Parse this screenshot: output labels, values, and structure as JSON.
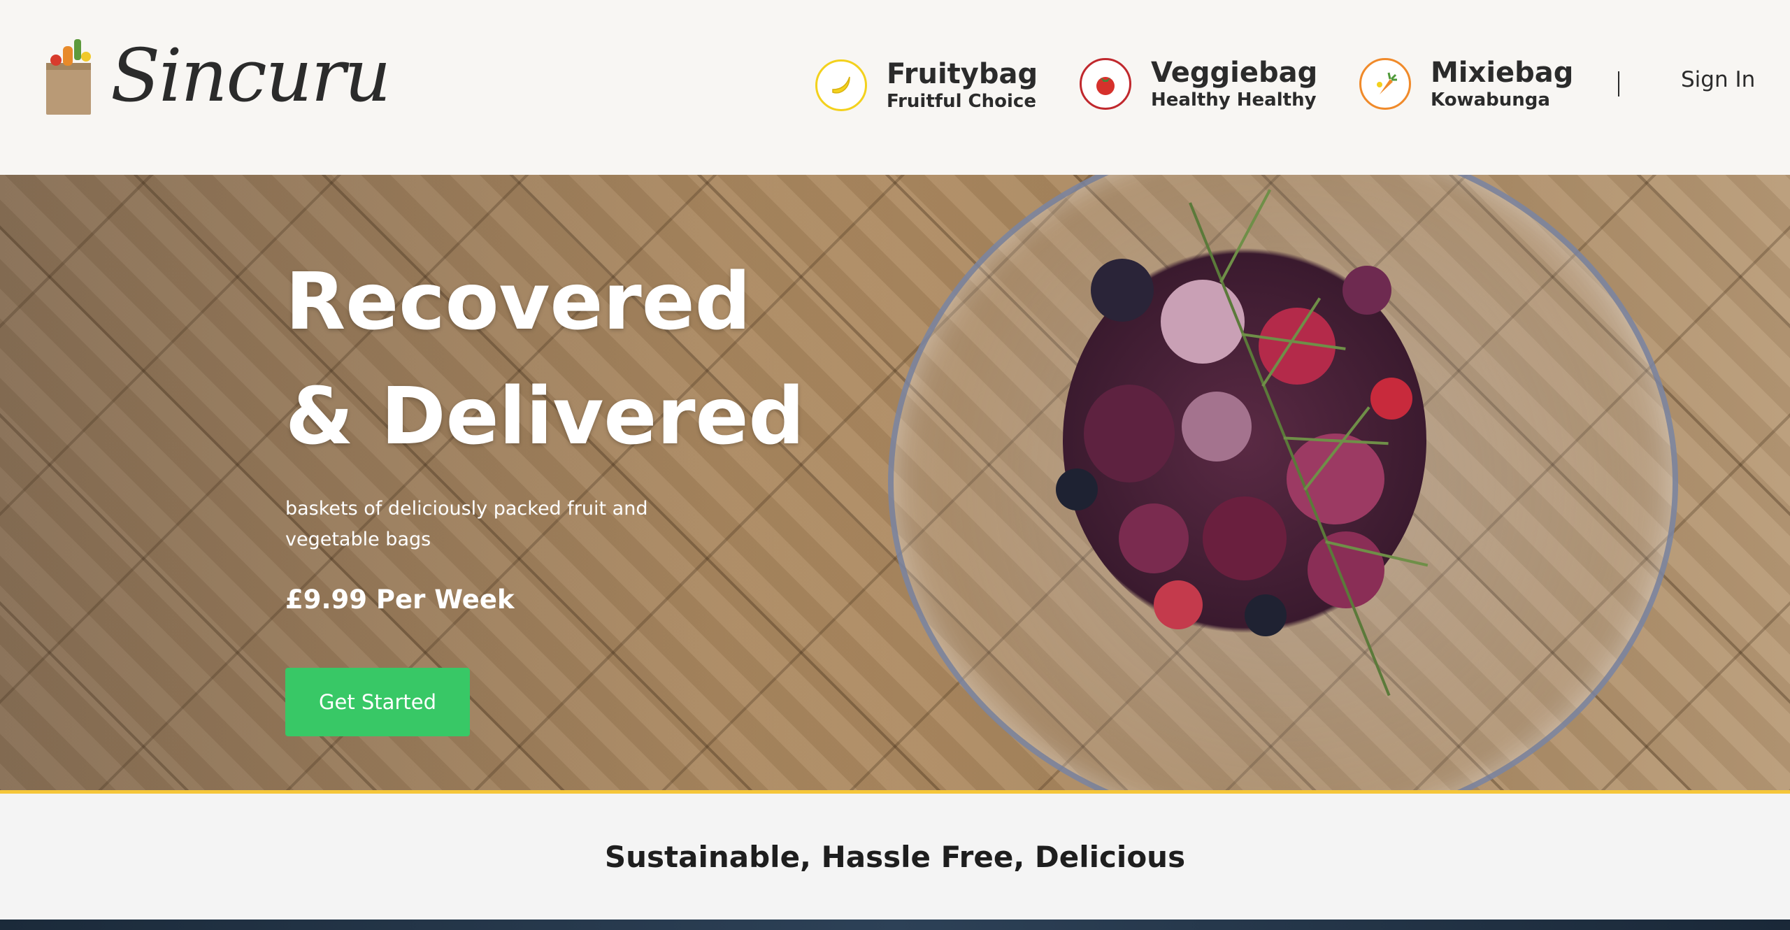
{
  "brand": {
    "name": "Sincuru",
    "logo_icon": "grocery-bag-icon"
  },
  "nav": {
    "items": [
      {
        "title": "Fruitybag",
        "subtitle": "Fruitful Choice",
        "icon": "banana-icon",
        "color": "#f3d11d"
      },
      {
        "title": "Veggiebag",
        "subtitle": "Healthy Healthy",
        "icon": "tomato-icon",
        "color": "#c0282d"
      },
      {
        "title": "Mixiebag",
        "subtitle": "Kowabunga",
        "icon": "carrot-icon",
        "color": "#f08a2a"
      }
    ],
    "separator": "|",
    "sign_in": "Sign In"
  },
  "hero": {
    "title_line1": "Recovered",
    "title_line2": "& Delivered",
    "description": "baskets of deliciously packed fruit and vegetable bags",
    "price": "£9.99 Per Week",
    "cta_label": "Get Started",
    "cta_color": "#38c866",
    "accent_line_color": "#f5c63a"
  },
  "tagline": "Sustainable, Hassle Free, Delicious"
}
